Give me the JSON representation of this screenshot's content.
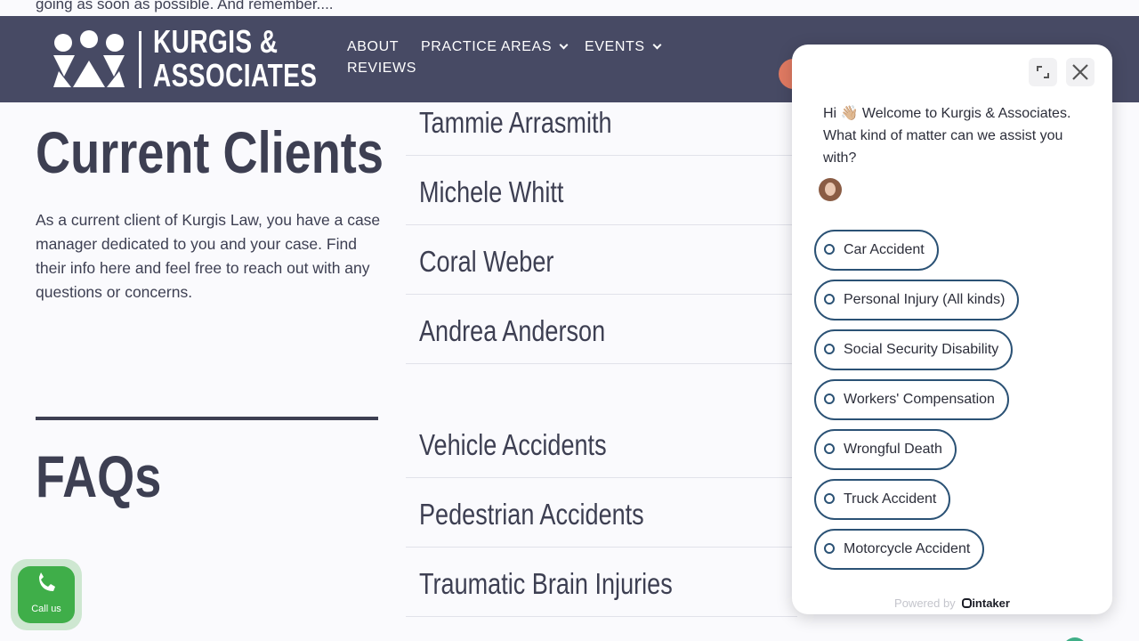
{
  "top_strip": {
    "text": "going as soon as possible. And remember...."
  },
  "header": {
    "logo": {
      "line1": "KURGIS &",
      "line2": "ASSOCIATES"
    },
    "nav": [
      {
        "label": "ABOUT",
        "has_dropdown": false
      },
      {
        "label": "PRACTICE AREAS",
        "has_dropdown": true
      },
      {
        "label": "EVENTS",
        "has_dropdown": true
      },
      {
        "label": "REVIEWS",
        "has_dropdown": false
      }
    ],
    "social_icons": [
      "social-icon-1",
      "social-icon-2",
      "social-icon-3",
      "social-icon-4"
    ]
  },
  "main": {
    "current_clients_title": "Current Clients",
    "intro": "As a current client of Kurgis Law, you have a case manager dedicated to you and your case. Find their info here and feel free to reach out with any questions or concerns.",
    "case_managers": [
      "Tammie Arrasmith",
      "Michele Whitt",
      "Coral Weber",
      "Andrea Anderson"
    ],
    "faq_title": "FAQs",
    "faq_topics": [
      "Vehicle Accidents",
      "Pedestrian Accidents",
      "Traumatic Brain Injuries"
    ]
  },
  "chat": {
    "greeting": "Hi 👋🏼 Welcome to Kurgis & Associates. What kind of matter can we assist you with?",
    "options": [
      "Car Accident",
      "Personal Injury (All kinds)",
      "Social Security Disability",
      "Workers' Compensation",
      "Wrongful Death",
      "Truck Accident",
      "Motorcycle Accident"
    ],
    "powered_by": "Powered by",
    "brand": "intaker"
  },
  "call_button": {
    "label": "Call us"
  },
  "colors": {
    "header_bg": "#474a64",
    "text": "#3d3f52",
    "option_border": "#2b5275",
    "call_green": "#3fae49",
    "social_orange": "#e07a62"
  }
}
